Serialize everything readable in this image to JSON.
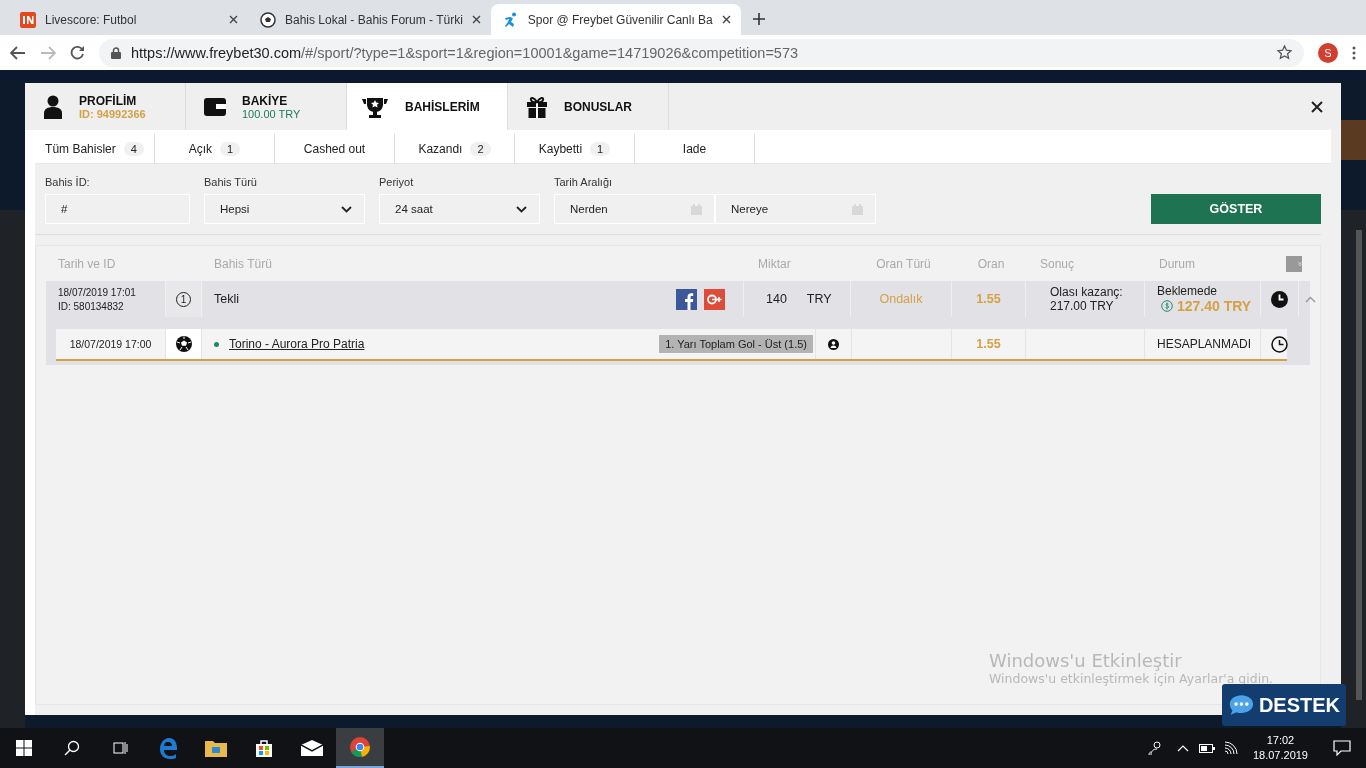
{
  "browser": {
    "tabs": [
      {
        "kind": "livescore",
        "title": "Livescore: Futbol",
        "selected": false
      },
      {
        "kind": "ball",
        "title": "Bahis Lokal - Bahis Forum - Türki",
        "selected": false
      },
      {
        "kind": "runner",
        "title": "Spor @ Freybet Güvenilir Canlı Ba",
        "selected": true
      }
    ],
    "url_host": "https://www.freybet30.com",
    "url_path": "/#/sport/?type=1&sport=1&region=10001&game=14719026&competition=573",
    "profile": "S"
  },
  "modal": {
    "tabs": [
      {
        "kind": "profile",
        "label": "PROFİLİM",
        "sub": "ID: 94992366",
        "selected": false
      },
      {
        "kind": "wallet",
        "label": "BAKİYE",
        "sub": "100.00 TRY",
        "selected": false
      },
      {
        "kind": "trophy",
        "label": "BAHİSLERİM",
        "selected": true
      },
      {
        "kind": "gift",
        "label": "BONUSLAR",
        "selected": false
      }
    ],
    "filter_tabs": [
      {
        "label": "Tüm Bahisler",
        "count": "4"
      },
      {
        "label": "Açık",
        "count": "1"
      },
      {
        "label": "Cashed out"
      },
      {
        "label": "Kazandı",
        "count": "2"
      },
      {
        "label": "Kaybetti",
        "count": "1"
      },
      {
        "label": "Iade"
      }
    ],
    "filters": {
      "bet_id": {
        "label": "Bahis İD:",
        "value": "#"
      },
      "bet_type": {
        "label": "Bahis Türü",
        "value": "Hepsi"
      },
      "period": {
        "label": "Periyot",
        "value": "24 saat"
      },
      "date_range": {
        "label": "Tarih Aralığı",
        "from": "Nerden",
        "to": "Nereye"
      },
      "show_button": "GÖSTER"
    },
    "table": {
      "columns": [
        "Tarih ve ID",
        "Bahis Türü",
        "Miktar",
        "Oran Türü",
        "Oran",
        "Sonuç",
        "Durum"
      ],
      "bets": [
        {
          "date": "18/07/2019 17:01",
          "id": "ID: 580134832",
          "count_mark": "1",
          "type": "Tekli",
          "amount": "140",
          "currency": "TRY",
          "odds_type": "Ondalık",
          "odds": "1.55",
          "result_label": "Olası kazanç:",
          "result_value": "217.00 TRY",
          "status": "Beklemede",
          "cashout": "127.40 TRY",
          "expanded": true,
          "selections": [
            {
              "date": "18/07/2019 17:00",
              "match": "Torino - Aurora Pro Patria",
              "market": "1. Yarı Toplam Gol - Üst (1.5)",
              "odds": "1.55",
              "status": "HESAPLANMADI"
            }
          ]
        }
      ]
    }
  },
  "activation": {
    "title": "Windows'u Etkinleştir",
    "subtitle": "Windows'u etkinleştirmek için Ayarlar'a gidin."
  },
  "support_button": "DESTEK",
  "taskbar": {
    "time": "17:02",
    "date": "18.07.2019"
  }
}
